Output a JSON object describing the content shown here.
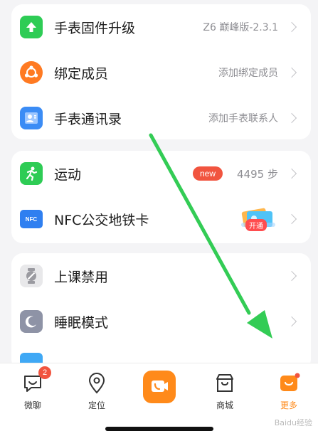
{
  "card1": {
    "items": [
      {
        "label": "手表固件升级",
        "value": "Z6 巅峰版-2.3.1",
        "icon": "upload-arrow-icon",
        "color": "#2ecc55"
      },
      {
        "label": "绑定成员",
        "value": "添加绑定成员",
        "icon": "members-icon",
        "color": "#ff7a22"
      },
      {
        "label": "手表通讯录",
        "value": "添加手表联系人",
        "icon": "contact-card-icon",
        "color": "#3b8cf5"
      }
    ]
  },
  "card2": {
    "sport": {
      "label": "运动",
      "badge": "new",
      "value": "4495 步",
      "icon": "running-person-icon",
      "color": "#2ecc55"
    },
    "nfc": {
      "label": "NFC公交地铁卡",
      "icon": "nfc-card-icon",
      "icon_text": "NFC",
      "promo_tag": "开通"
    }
  },
  "card3": {
    "items": [
      {
        "label": "上课禁用",
        "icon": "class-mode-watch-icon"
      },
      {
        "label": "睡眠模式",
        "icon": "moon-icon"
      }
    ]
  },
  "nav": [
    {
      "label": "微聊",
      "icon": "chat-icon",
      "badge": "2"
    },
    {
      "label": "定位",
      "icon": "location-pin-icon"
    },
    {
      "label": "",
      "icon": "video-call-icon"
    },
    {
      "label": "商城",
      "icon": "store-icon"
    },
    {
      "label": "更多",
      "icon": "more-icon",
      "active": true
    }
  ],
  "watermark": "Baidu经验",
  "colors": {
    "accent_orange": "#ff8a1a",
    "badge_red": "#f1543f",
    "annotation_arrow": "#33cc55"
  }
}
